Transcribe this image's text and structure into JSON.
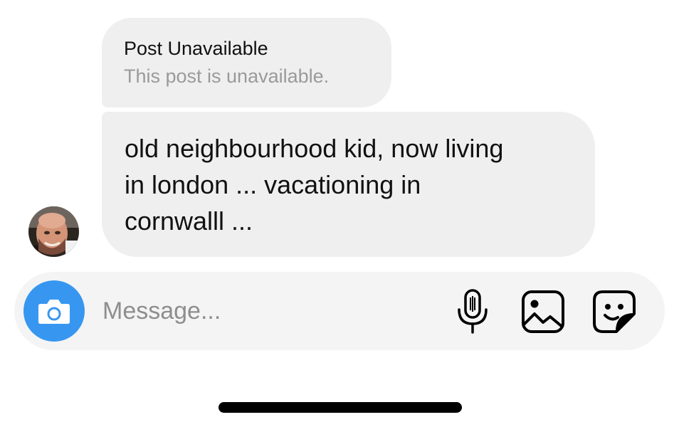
{
  "thread": {
    "shared_post": {
      "title": "Post Unavailable",
      "subtitle": "This post is unavailable."
    },
    "message": {
      "line1": "old neighbourhood kid, now living",
      "line2": "in london ... vacationing in",
      "line3": "cornwalll ..."
    },
    "sender": {
      "avatar_icon": "profile-photo"
    }
  },
  "composer": {
    "placeholder": "Message...",
    "camera_icon": "camera-icon",
    "mic_icon": "microphone-icon",
    "gallery_icon": "image-gallery-icon",
    "sticker_icon": "sticker-icon"
  },
  "colors": {
    "bubble_bg": "#efefef",
    "composer_bg": "#f4f4f4",
    "accent": "#3797f0",
    "muted_text": "#9a9a9a",
    "text": "#111111"
  }
}
